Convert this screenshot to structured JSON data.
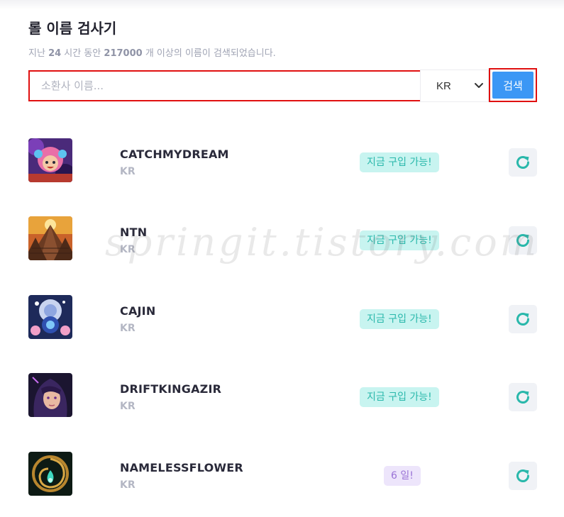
{
  "header": {
    "title": "롤 이름 검사기",
    "subtitle_prefix": "지난",
    "subtitle_hours": "24",
    "subtitle_mid": "시간 동안",
    "subtitle_count": "217000",
    "subtitle_suffix": "개 이상의 이름이 검색되었습니다."
  },
  "search": {
    "placeholder": "소환사 이름...",
    "value": "",
    "region_selected": "KR",
    "button_label": "검색"
  },
  "results": [
    {
      "name": "CATCHMYDREAM",
      "region": "KR",
      "status": "지금 구입 가능!",
      "status_type": "available",
      "icon": "champion-avatar-pink-hair"
    },
    {
      "name": "NTN",
      "region": "KR",
      "status": "지금 구입 가능!",
      "status_type": "available",
      "icon": "pyramid-avatar"
    },
    {
      "name": "CAJIN",
      "region": "KR",
      "status": "지금 구입 가능!",
      "status_type": "available",
      "icon": "crystal-orb-avatar"
    },
    {
      "name": "DRIFTKINGAZIR",
      "region": "KR",
      "status": "지금 구입 가능!",
      "status_type": "available",
      "icon": "dark-hair-champion-avatar"
    },
    {
      "name": "NAMELESSFLOWER",
      "region": "KR",
      "status": "6 일!",
      "status_type": "days",
      "icon": "golden-spiral-flame-avatar"
    }
  ],
  "watermark": "springit.tistory.com",
  "colors": {
    "accent": "#3b97f5",
    "available_bg": "#c8f4f0",
    "available_text": "#2ab8ab",
    "days_bg": "#ede5fb",
    "days_text": "#9a73d6",
    "refresh_icon": "#2ab8ab",
    "highlight_border": "#e01010"
  }
}
